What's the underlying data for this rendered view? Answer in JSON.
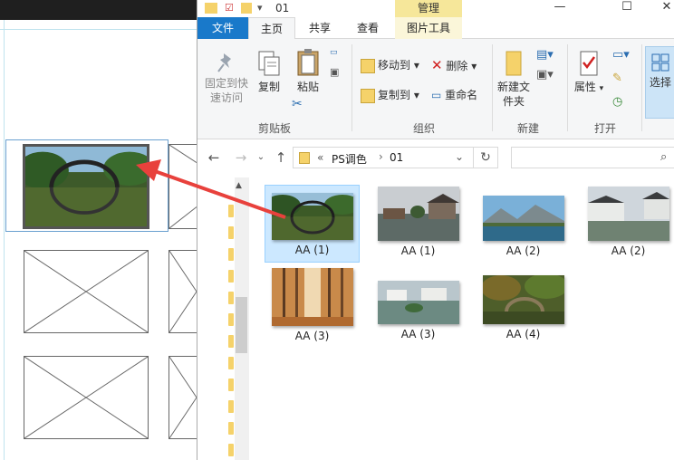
{
  "window": {
    "title": "01",
    "contextual_tab": "管理"
  },
  "tabs": {
    "file": "文件",
    "home": "主页",
    "share": "共享",
    "view": "查看",
    "picture_tools": "图片工具"
  },
  "ribbon": {
    "pin": "固定到快速访问",
    "copy": "复制",
    "paste": "粘贴",
    "clipboard_group": "剪贴板",
    "move_to": "移动到",
    "copy_to": "复制到",
    "delete": "删除",
    "rename": "重命名",
    "organize_group": "组织",
    "new_folder": "新建文件夹",
    "new_group": "新建",
    "properties": "属性",
    "open_group": "打开",
    "select": "选择"
  },
  "address": {
    "prefix": "«",
    "crumbs": [
      "PS调色",
      "01"
    ],
    "search_placeholder": ""
  },
  "files": [
    {
      "name": "AA (1)",
      "selected": true,
      "thumb": "arch-bridge-reflection"
    },
    {
      "name": "AA (1)",
      "selected": false,
      "thumb": "riverside-village"
    },
    {
      "name": "AA (2)",
      "selected": false,
      "thumb": "mountain-lake"
    },
    {
      "name": "AA (2)",
      "selected": false,
      "thumb": "canal-houses"
    },
    {
      "name": "AA (3)",
      "selected": false,
      "thumb": "autumn-forest"
    },
    {
      "name": "AA (3)",
      "selected": false,
      "thumb": "white-houses-lake"
    },
    {
      "name": "AA (4)",
      "selected": false,
      "thumb": "stone-bridge-forest"
    }
  ],
  "colors": {
    "file_tab": "#1979ca",
    "manage_tab": "#f6e79a",
    "selection": "#cce8ff",
    "arrow": "#e8413c"
  }
}
